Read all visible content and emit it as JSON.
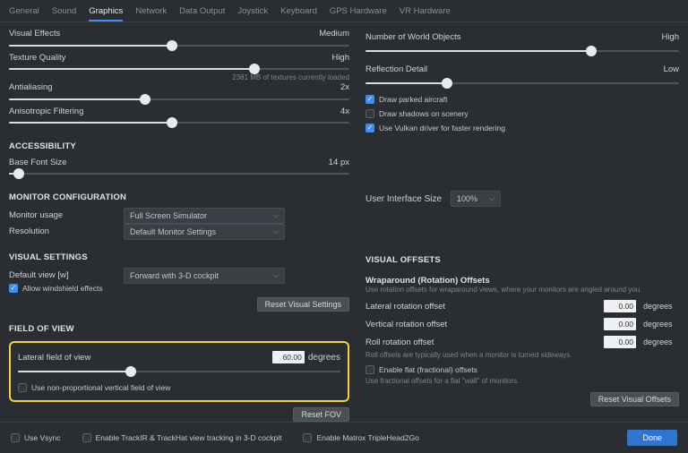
{
  "tabs": [
    "General",
    "Sound",
    "Graphics",
    "Network",
    "Data Output",
    "Joystick",
    "Keyboard",
    "GPS Hardware",
    "VR Hardware"
  ],
  "active_tab": 2,
  "left": {
    "visual_effects": {
      "label": "Visual Effects",
      "value": "Medium",
      "pct": 48
    },
    "texture_quality": {
      "label": "Texture Quality",
      "value": "High",
      "pct": 72,
      "note": "2381 MB of textures currently loaded"
    },
    "antialiasing": {
      "label": "Antialiasing",
      "value": "2x",
      "pct": 40
    },
    "anisotropic": {
      "label": "Anisotropic Filtering",
      "value": "4x",
      "pct": 48
    },
    "accessibility": {
      "head": "ACCESSIBILITY",
      "base_font": {
        "label": "Base Font Size",
        "value": "14 px",
        "pct": 3
      }
    },
    "monitor": {
      "head": "MONITOR CONFIGURATION",
      "usage": {
        "label": "Monitor usage",
        "value": "Full Screen Simulator"
      },
      "resolution": {
        "label": "Resolution",
        "value": "Default Monitor Settings"
      }
    },
    "visual_settings": {
      "head": "VISUAL SETTINGS",
      "default_view": {
        "label": "Default view [w]",
        "value": "Forward with 3-D cockpit"
      },
      "allow_windshield": {
        "label": "Allow windshield effects",
        "checked": true
      },
      "reset_btn": "Reset Visual Settings"
    },
    "fov": {
      "head": "FIELD OF VIEW",
      "lateral": {
        "label": "Lateral field of view",
        "value": "60.00",
        "unit": "degrees",
        "pct": 35
      },
      "nonprop": {
        "label": "Use non-proportional vertical field of view",
        "checked": false
      },
      "reset_btn": "Reset FOV"
    }
  },
  "right": {
    "world_objects": {
      "label": "Number of World Objects",
      "value": "High",
      "pct": 72
    },
    "reflection": {
      "label": "Reflection Detail",
      "value": "Low",
      "pct": 26
    },
    "checks": [
      {
        "label": "Draw parked aircraft",
        "checked": true
      },
      {
        "label": "Draw shadows on scenery",
        "checked": false
      },
      {
        "label": "Use Vulkan driver for faster rendering",
        "checked": true
      }
    ],
    "ui_size": {
      "label": "User Interface Size",
      "value": "100%"
    },
    "visual_offsets": {
      "head": "VISUAL OFFSETS",
      "wrap_head": "Wraparound (Rotation) Offsets",
      "wrap_desc": "Use rotation offsets for wraparound views, where your monitors are angled around you.",
      "rows": [
        {
          "label": "Lateral rotation offset",
          "value": "0.00",
          "unit": "degrees"
        },
        {
          "label": "Vertical rotation offset",
          "value": "0.00",
          "unit": "degrees"
        },
        {
          "label": "Roll rotation offset",
          "value": "0.00",
          "unit": "degrees"
        }
      ],
      "roll_desc": "Roll offsets are typically used when a monitor is turned sideways.",
      "flat_check": {
        "label": "Enable flat (fractional) offsets",
        "checked": false
      },
      "flat_desc": "Use fractional offsets for a flat \"wall\" of monitors.",
      "reset_btn": "Reset Visual Offsets"
    }
  },
  "footer": {
    "checks": [
      {
        "label": "Use Vsync",
        "checked": false
      },
      {
        "label": "Enable TrackIR & TrackHat view tracking in 3-D cockpit",
        "checked": false
      },
      {
        "label": "Enable Matrox TripleHead2Go",
        "checked": false
      }
    ],
    "done": "Done"
  }
}
